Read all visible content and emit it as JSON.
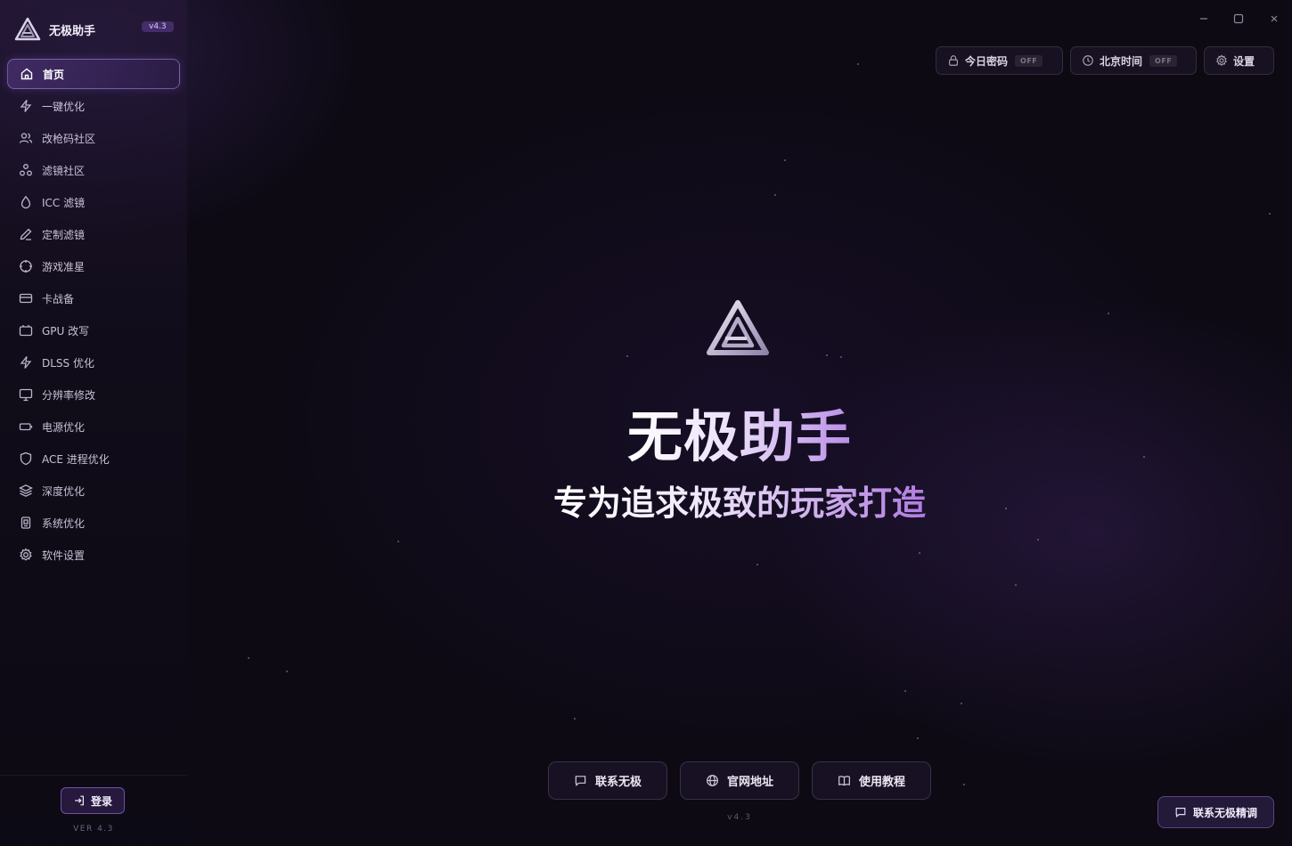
{
  "app": {
    "name": "无极助手",
    "version_badge": "v4.3"
  },
  "sidebar": {
    "items": [
      {
        "label": "首页",
        "icon": "home-icon",
        "active": true
      },
      {
        "label": "一键优化",
        "icon": "lightning-icon"
      },
      {
        "label": "改枪码社区",
        "icon": "users-icon"
      },
      {
        "label": "滤镜社区",
        "icon": "nodes-icon"
      },
      {
        "label": "ICC 滤镜",
        "icon": "droplet-icon"
      },
      {
        "label": "定制滤镜",
        "icon": "pen-icon"
      },
      {
        "label": "游戏准星",
        "icon": "crosshair-icon"
      },
      {
        "label": "卡战备",
        "icon": "card-icon"
      },
      {
        "label": "GPU 改写",
        "icon": "gpu-icon"
      },
      {
        "label": "DLSS 优化",
        "icon": "lightning-icon"
      },
      {
        "label": "分辨率修改",
        "icon": "monitor-icon"
      },
      {
        "label": "电源优化",
        "icon": "battery-icon"
      },
      {
        "label": "ACE 进程优化",
        "icon": "shield-icon"
      },
      {
        "label": "深度优化",
        "icon": "layers-icon"
      },
      {
        "label": "系统优化",
        "icon": "chip-icon"
      },
      {
        "label": "软件设置",
        "icon": "gear-icon"
      }
    ],
    "login_label": "登录",
    "version_text": "VER 4.3"
  },
  "topbar": {
    "password_label": "今日密码",
    "password_state": "OFF",
    "time_label": "北京时间",
    "time_state": "OFF",
    "settings_label": "设置"
  },
  "hero": {
    "title": "无极助手",
    "subtitle": "专为追求极致的玩家打造"
  },
  "actions": {
    "contact": "联系无极",
    "website": "官网地址",
    "tutorial": "使用教程"
  },
  "footer": {
    "version": "v4.3",
    "contact_tune": "联系无极精调"
  },
  "colors": {
    "background": "#0d0a14",
    "accent": "#a57be0",
    "active_border": "#aa8ce6"
  }
}
